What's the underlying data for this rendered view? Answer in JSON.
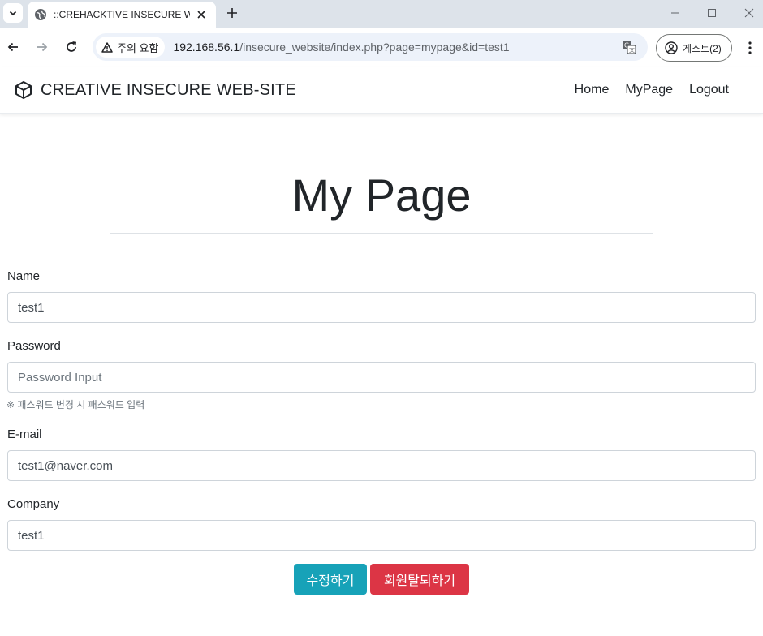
{
  "browser": {
    "tab_title": "::CREHACKTIVE INSECURE WEB",
    "security_label": "주의 요함",
    "url_host": "192.168.56.1",
    "url_path": "/insecure_website/index.php?page=mypage&id=test1",
    "profile_label": "게스트(2)"
  },
  "site": {
    "brand": "CREATIVE INSECURE WEB-SITE",
    "nav": [
      {
        "label": "Home"
      },
      {
        "label": "MyPage"
      },
      {
        "label": "Logout"
      }
    ]
  },
  "page": {
    "title": "My Page"
  },
  "form": {
    "name": {
      "label": "Name",
      "value": "test1"
    },
    "password": {
      "label": "Password",
      "value": "",
      "placeholder": "Password Input",
      "help": "※ 패스워드 변경 시 패스워드 입력"
    },
    "email": {
      "label": "E-mail",
      "value": "test1@naver.com"
    },
    "company": {
      "label": "Company",
      "value": "test1"
    },
    "edit_button": "수정하기",
    "withdraw_button": "회원탈퇴하기"
  },
  "colors": {
    "edit_button": "#17a2b8",
    "withdraw_button": "#dc3545"
  }
}
